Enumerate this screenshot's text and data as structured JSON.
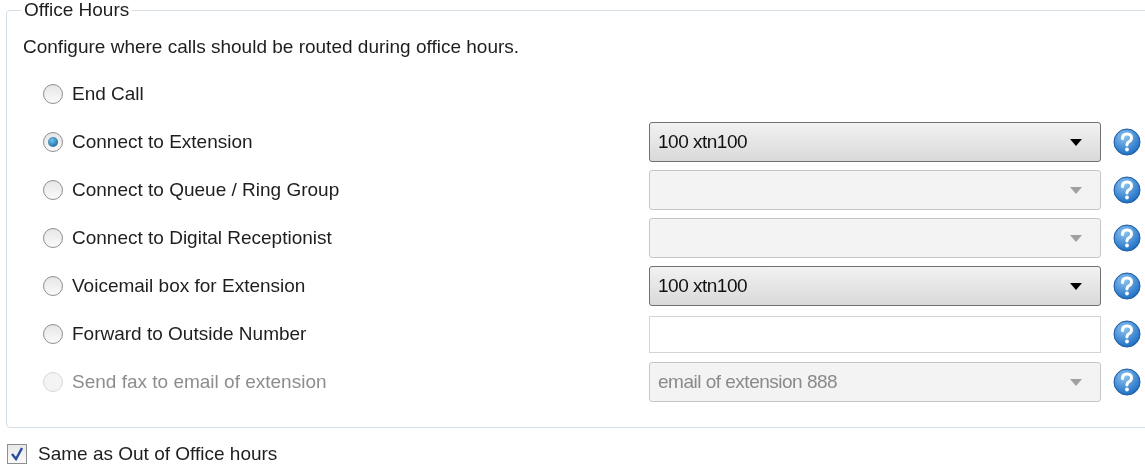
{
  "group": {
    "title": "Office Hours",
    "description": "Configure where calls should be routed during office hours."
  },
  "options": [
    {
      "label": "End Call",
      "selected": false,
      "disabled": false
    },
    {
      "label": "Connect to Extension",
      "selected": true,
      "disabled": false,
      "control": {
        "kind": "dropdown",
        "value": "100 xtn100",
        "disabled": false
      }
    },
    {
      "label": "Connect to Queue / Ring Group",
      "selected": false,
      "disabled": false,
      "control": {
        "kind": "dropdown",
        "disabled": true
      }
    },
    {
      "label": "Connect to Digital Receptionist",
      "selected": false,
      "disabled": false,
      "control": {
        "kind": "dropdown",
        "disabled": true
      }
    },
    {
      "label": "Voicemail box for Extension",
      "selected": false,
      "disabled": false,
      "control": {
        "kind": "dropdown",
        "value": "100 xtn100",
        "disabled": false
      }
    },
    {
      "label": "Forward to Outside Number",
      "selected": false,
      "disabled": false,
      "control": {
        "kind": "text"
      }
    },
    {
      "label": "Send fax to email of extension",
      "selected": false,
      "disabled": true,
      "control": {
        "kind": "dropdown",
        "value": "email of extension 888",
        "disabled": true
      }
    }
  ],
  "same_as_out_of_office": {
    "label": "Same as Out of Office hours",
    "checked": true
  }
}
